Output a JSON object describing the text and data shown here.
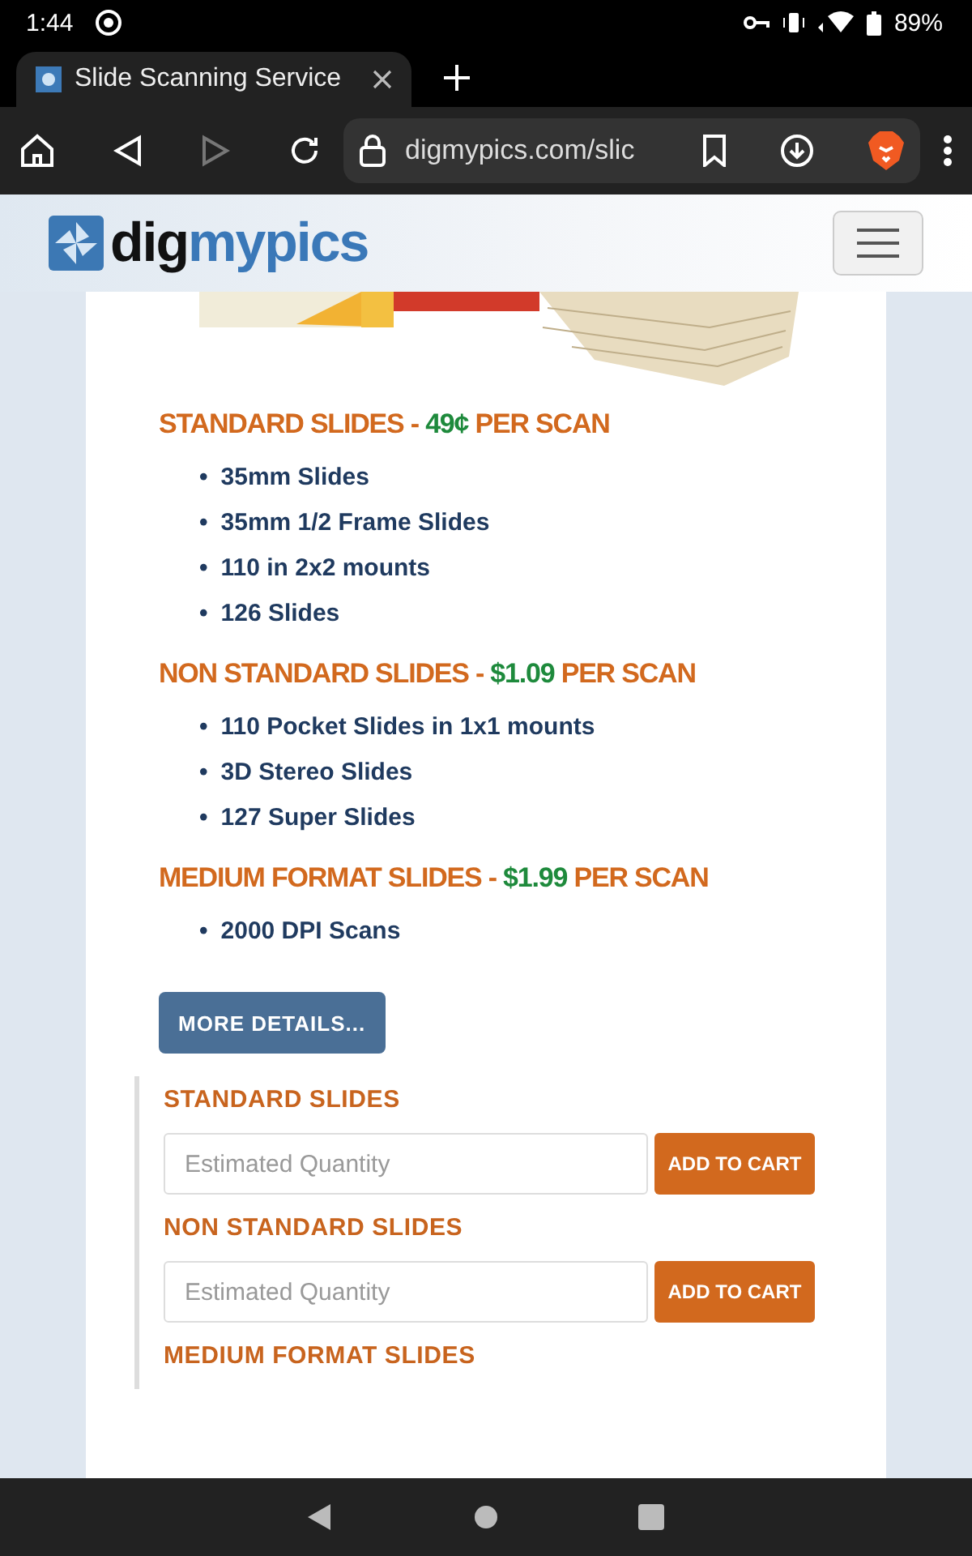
{
  "status_bar": {
    "time": "1:44",
    "battery": "89%"
  },
  "tab": {
    "title": "Slide Scanning Service",
    "selected": true
  },
  "address_bar": {
    "url": "digmypics.com/slic"
  },
  "site": {
    "logo_dark": "dig",
    "logo_light": "mypics"
  },
  "sections": [
    {
      "name": "STANDARD SLIDES -",
      "price": "49¢",
      "unit": "PER SCAN",
      "items": [
        "35mm Slides",
        "35mm 1/2 Frame Slides",
        "110 in 2x2 mounts",
        "126 Slides"
      ]
    },
    {
      "name": "NON STANDARD SLIDES -",
      "price": "$1.09",
      "unit": "PER SCAN",
      "items": [
        "110 Pocket Slides in 1x1 mounts",
        "3D Stereo Slides",
        "127 Super Slides"
      ]
    },
    {
      "name": "MEDIUM FORMAT SLIDES -",
      "price": "$1.99",
      "unit": "PER SCAN",
      "items": [
        "2000 DPI Scans"
      ]
    }
  ],
  "bullet": "•",
  "more_button": "MORE DETAILS...",
  "order_form": [
    {
      "label": "STANDARD SLIDES",
      "placeholder": "Estimated Quantity",
      "button": "ADD TO CART"
    },
    {
      "label": "NON STANDARD SLIDES",
      "placeholder": "Estimated Quantity",
      "button": "ADD TO CART"
    },
    {
      "label": "MEDIUM FORMAT SLIDES"
    }
  ]
}
